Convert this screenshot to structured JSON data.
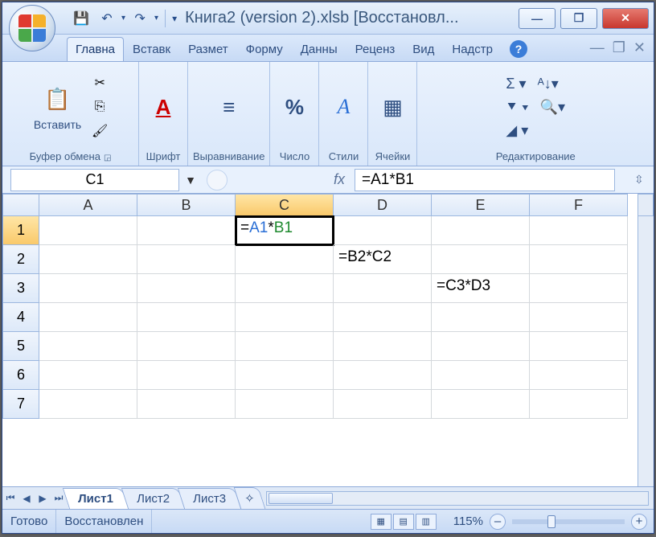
{
  "title": "Книга2 (version 2).xlsb [Восстановл...",
  "window_controls": {
    "min": "—",
    "max": "❐",
    "close": "✕"
  },
  "qat": {
    "save": "💾",
    "undo": "↶",
    "redo": "↷"
  },
  "ribbon_tabs": [
    "Главна",
    "Вставк",
    "Размет",
    "Форму",
    "Данны",
    "Реценз",
    "Вид",
    "Надстр"
  ],
  "active_tab_index": 0,
  "ribbon": {
    "clipboard": {
      "paste": "Вставить",
      "label": "Буфер обмена",
      "cut": "✂",
      "copy": "⎘",
      "painter": "🖌"
    },
    "font": {
      "icon": "A",
      "label": "Шрифт"
    },
    "align": {
      "icon": "≡",
      "label": "Выравнивание"
    },
    "number": {
      "icon": "%",
      "label": "Число"
    },
    "styles": {
      "icon": "A",
      "label": "Стили"
    },
    "cells": {
      "icon": "▦",
      "label": "Ячейки"
    },
    "editing": {
      "sum": "Σ ▾",
      "sort": "ᴬ↓▾",
      "fill": "⯆ ▾",
      "find": "🔍▾",
      "clear": "◢ ▾",
      "label": "Редактирование"
    }
  },
  "doc_controls": {
    "min": "—",
    "restore": "❐",
    "close": "✕"
  },
  "name_box": "C1",
  "fx_label": "fx",
  "formula_bar": "=A1*B1",
  "columns": [
    "A",
    "B",
    "C",
    "D",
    "E",
    "F"
  ],
  "active_col_index": 2,
  "rows": [
    "1",
    "2",
    "3",
    "4",
    "5",
    "6",
    "7"
  ],
  "active_row_index": 0,
  "cells": {
    "C1": {
      "prefix": "=",
      "a": "A1",
      "op": "*",
      "b": "B1"
    },
    "D2": "=B2*C2",
    "E3": "=C3*D3"
  },
  "sheet_tabs": [
    "Лист1",
    "Лист2",
    "Лист3"
  ],
  "active_sheet_index": 0,
  "new_sheet_icon": "✧",
  "status": {
    "ready": "Готово",
    "recovered": "Восстановлен",
    "zoom": "115%"
  },
  "zoom_controls": {
    "minus": "–",
    "plus": "+"
  }
}
